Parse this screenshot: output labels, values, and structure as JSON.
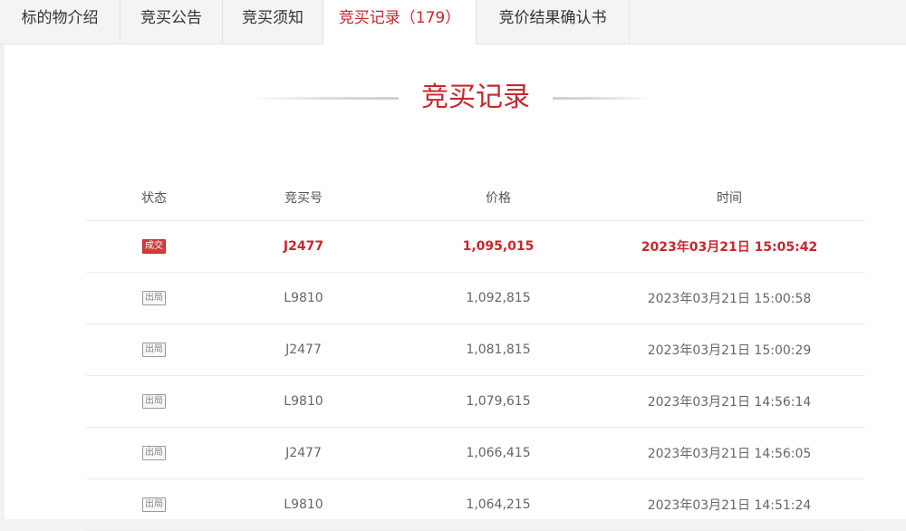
{
  "tabs": [
    {
      "label": "标的物介绍"
    },
    {
      "label": "竞买公告"
    },
    {
      "label": "竞买须知"
    },
    {
      "label": "竞买记录（179）",
      "active": true
    },
    {
      "label": "竞价结果确认书"
    }
  ],
  "section": {
    "title": "竞买记录"
  },
  "table": {
    "headers": {
      "status": "状态",
      "bid_no": "竞买号",
      "price": "价格",
      "time": "时间"
    },
    "rows": [
      {
        "status": "成交",
        "bid_no": "J2477",
        "price": "1,095,015",
        "time": "2023年03月21日 15:05:42",
        "winner": true
      },
      {
        "status": "出局",
        "bid_no": "L9810",
        "price": "1,092,815",
        "time": "2023年03月21日 15:00:58"
      },
      {
        "status": "出局",
        "bid_no": "J2477",
        "price": "1,081,815",
        "time": "2023年03月21日 15:00:29"
      },
      {
        "status": "出局",
        "bid_no": "L9810",
        "price": "1,079,615",
        "time": "2023年03月21日 14:56:14"
      },
      {
        "status": "出局",
        "bid_no": "J2477",
        "price": "1,066,415",
        "time": "2023年03月21日 14:56:05"
      },
      {
        "status": "出局",
        "bid_no": "L9810",
        "price": "1,064,215",
        "time": "2023年03月21日 14:51:24"
      }
    ]
  },
  "colors": {
    "accent": "#c8272e",
    "deal_badge": "#d23b3b",
    "text": "#666666"
  }
}
